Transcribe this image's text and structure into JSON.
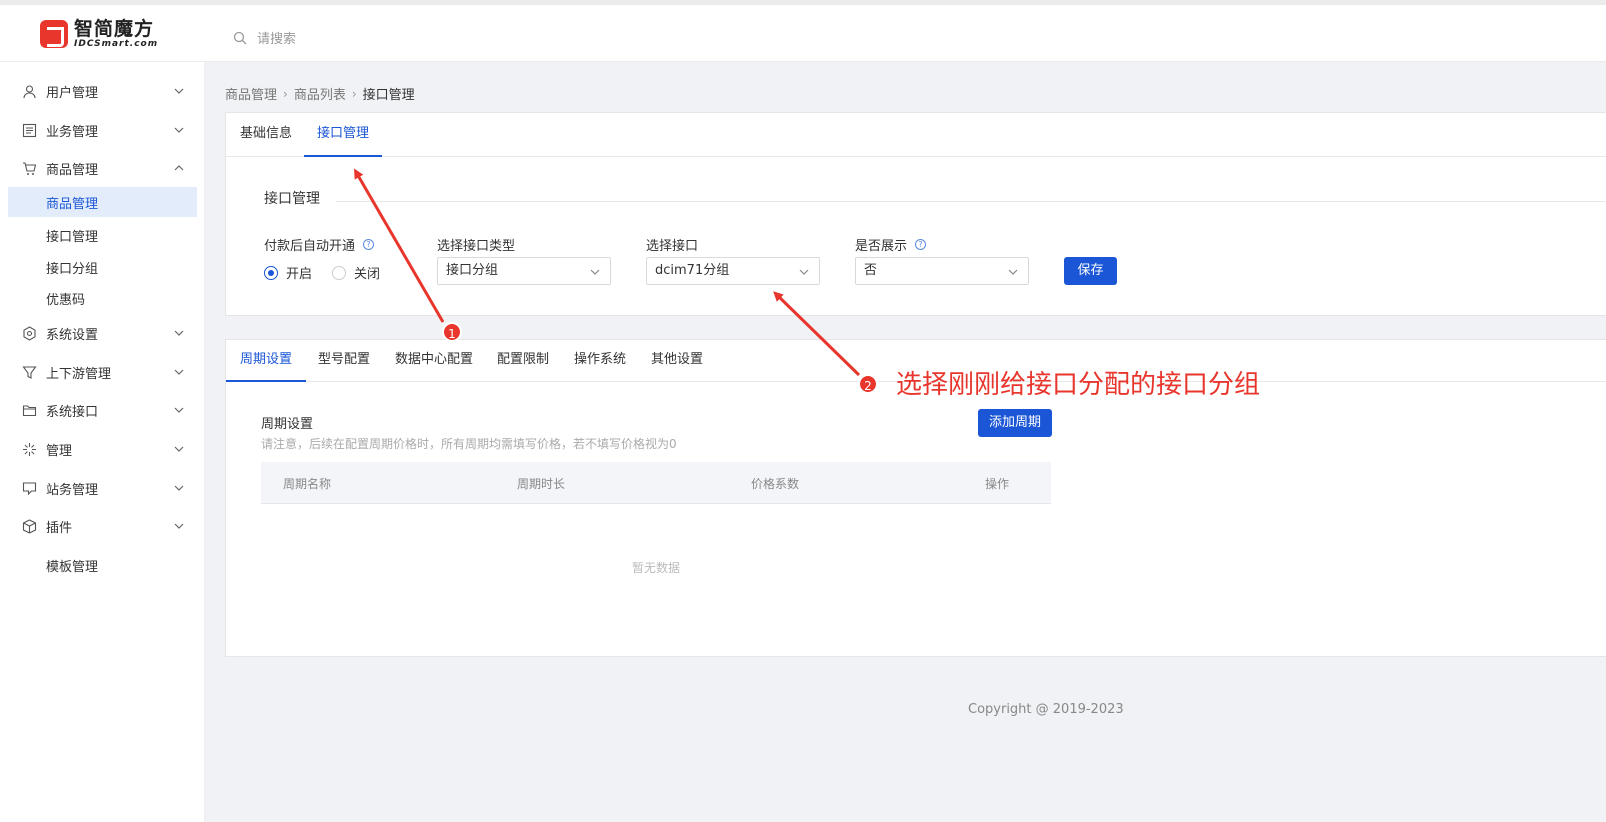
{
  "brand": {
    "name": "智简魔方",
    "sub": "IDCSmart.com"
  },
  "search": {
    "placeholder": "请搜索"
  },
  "sidebar": {
    "items": [
      {
        "label": "用户管理",
        "icon": "user-icon"
      },
      {
        "label": "业务管理",
        "icon": "list-icon"
      },
      {
        "label": "商品管理",
        "icon": "cart-icon",
        "expanded": true
      },
      {
        "label": "系统设置",
        "icon": "settings-icon"
      },
      {
        "label": "上下游管理",
        "icon": "filter-icon"
      },
      {
        "label": "系统接口",
        "icon": "folder-icon"
      },
      {
        "label": "管理",
        "icon": "sparkle-icon"
      },
      {
        "label": "站务管理",
        "icon": "chat-icon"
      },
      {
        "label": "插件",
        "icon": "cube-icon"
      }
    ],
    "sub_items": [
      "商品管理",
      "接口管理",
      "接口分组",
      "优惠码"
    ],
    "extra_item": "模板管理"
  },
  "breadcrumb": [
    "商品管理",
    "商品列表",
    "接口管理"
  ],
  "top_tabs": [
    "基础信息",
    "接口管理"
  ],
  "interface_section": {
    "title": "接口管理",
    "auto_open_label": "付款后自动开通",
    "radio_on": "开启",
    "radio_off": "关闭",
    "type_label": "选择接口类型",
    "type_value": "接口分组",
    "interface_label": "选择接口",
    "interface_value": "dcim71分组",
    "show_label": "是否展示",
    "show_value": "否",
    "save_label": "保存"
  },
  "bottom_tabs": [
    "周期设置",
    "型号配置",
    "数据中心配置",
    "配置限制",
    "操作系统",
    "其他设置"
  ],
  "period": {
    "title": "周期设置",
    "note": "请注意，后续在配置周期价格时，所有周期均需填写价格，若不填写价格视为0",
    "add_label": "添加周期",
    "columns": [
      "周期名称",
      "周期时长",
      "价格系数",
      "操作"
    ],
    "empty": "暂无数据"
  },
  "footer": {
    "copyright": "Copyright @ 2019-2023"
  },
  "annotations": {
    "badge1": "1",
    "badge2": "2",
    "note": "选择刚刚给接口分配的接口分组",
    "color": "#e8362d"
  },
  "colors": {
    "accent": "#1a56d6",
    "annotation": "#e8362d"
  }
}
